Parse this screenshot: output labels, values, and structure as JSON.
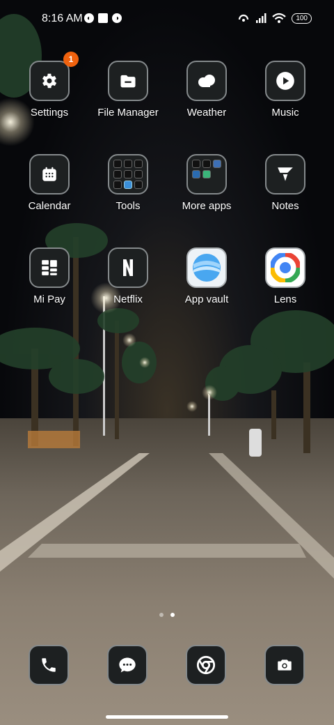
{
  "status_bar": {
    "time": "8:16 AM",
    "battery": "100"
  },
  "apps": [
    {
      "name": "settings",
      "label": "Settings",
      "icon": "gear-icon",
      "badge": "1"
    },
    {
      "name": "file-manager",
      "label": "File Manager",
      "icon": "folder-icon"
    },
    {
      "name": "weather",
      "label": "Weather",
      "icon": "cloud-icon"
    },
    {
      "name": "music",
      "label": "Music",
      "icon": "play-icon"
    },
    {
      "name": "calendar",
      "label": "Calendar",
      "icon": "calendar-icon"
    },
    {
      "name": "tools",
      "label": "Tools",
      "icon": "folder-grid-icon"
    },
    {
      "name": "more-apps",
      "label": "More apps",
      "icon": "folder-grid-icon"
    },
    {
      "name": "notes",
      "label": "Notes",
      "icon": "notes-icon"
    },
    {
      "name": "mi-pay",
      "label": "Mi Pay",
      "icon": "mipay-icon"
    },
    {
      "name": "netflix",
      "label": "Netflix",
      "icon": "netflix-icon"
    },
    {
      "name": "app-vault",
      "label": "App vault",
      "icon": "app-vault-icon"
    },
    {
      "name": "lens",
      "label": "Lens",
      "icon": "lens-icon"
    }
  ],
  "page_indicator": {
    "pages": 2,
    "current": 2
  },
  "dock": [
    {
      "name": "phone",
      "icon": "phone-icon"
    },
    {
      "name": "messages",
      "icon": "message-icon"
    },
    {
      "name": "chrome",
      "icon": "chrome-icon"
    },
    {
      "name": "camera",
      "icon": "camera-icon"
    }
  ],
  "colors": {
    "badge": "#f0620e",
    "tile_bg": "#1d2021",
    "tile_border": "#858a8c"
  }
}
